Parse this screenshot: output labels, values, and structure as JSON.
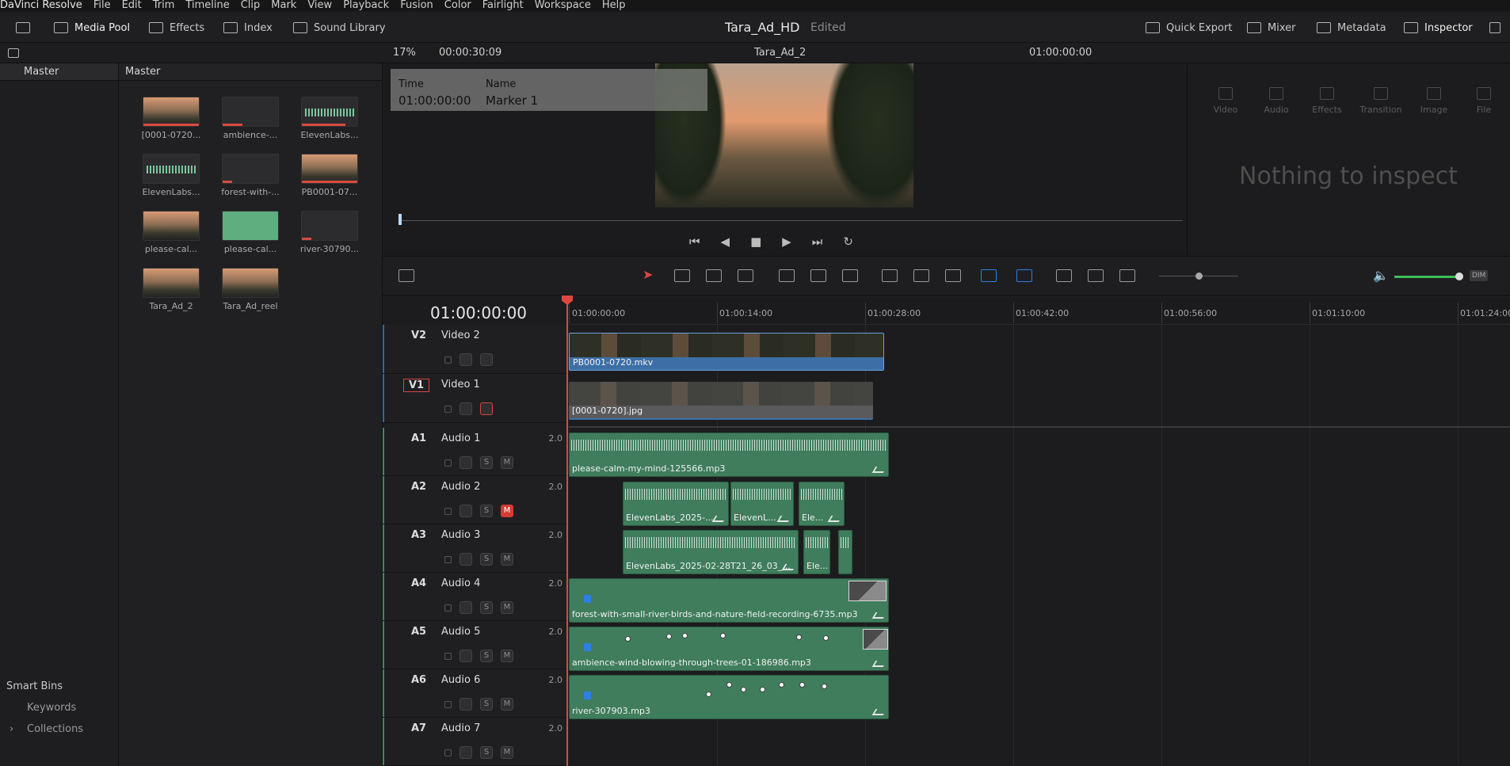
{
  "menubar": [
    "DaVinci Resolve",
    "File",
    "Edit",
    "Trim",
    "Timeline",
    "Clip",
    "Mark",
    "View",
    "Playback",
    "Fusion",
    "Color",
    "Fairlight",
    "Workspace",
    "Help"
  ],
  "toolbar": {
    "media_pool": "Media Pool",
    "effects": "Effects",
    "index": "Index",
    "sound_library": "Sound Library",
    "project_title": "Tara_Ad_HD",
    "edited": "Edited",
    "quick_export": "Quick Export",
    "mixer": "Mixer",
    "metadata": "Metadata",
    "inspector": "Inspector"
  },
  "strip2": {
    "zoom": "17%",
    "duration": "00:00:30:09",
    "timeline_name": "Tara_Ad_2",
    "timecode": "01:00:00:00"
  },
  "bins": {
    "master": "Master",
    "smart_bins": "Smart Bins",
    "keywords": "Keywords",
    "collections": "Collections"
  },
  "pool": {
    "header": "Master",
    "clips": [
      {
        "name": "[0001-0720..."
      },
      {
        "name": "ambience-..."
      },
      {
        "name": "ElevenLabs..."
      },
      {
        "name": "ElevenLabs..."
      },
      {
        "name": "forest-with-..."
      },
      {
        "name": "PB0001-07..."
      },
      {
        "name": "please-cal..."
      },
      {
        "name": "please-cal..."
      },
      {
        "name": "river-30790..."
      },
      {
        "name": "Tara_Ad_2"
      },
      {
        "name": "Tara_Ad_reel"
      }
    ]
  },
  "viewer": {
    "marker_time_label": "Time",
    "marker_name_label": "Name",
    "marker_time": "01:00:00:00",
    "marker_name": "Marker 1"
  },
  "inspector": {
    "tabs": [
      "Video",
      "Audio",
      "Effects",
      "Transition",
      "Image",
      "File"
    ],
    "empty_message": "Nothing to inspect"
  },
  "timeline": {
    "current_tc": "01:00:00:00",
    "ruler": [
      "01:00:00:00",
      "01:00:14:00",
      "01:00:28:00",
      "01:00:42:00",
      "01:00:56:00",
      "01:01:10:00",
      "01:01:24:00"
    ],
    "tracks": [
      {
        "id": "V2",
        "name": "Video 2"
      },
      {
        "id": "V1",
        "name": "Video 1"
      },
      {
        "id": "A1",
        "name": "Audio 1",
        "vol": "2.0"
      },
      {
        "id": "A2",
        "name": "Audio 2",
        "vol": "2.0"
      },
      {
        "id": "A3",
        "name": "Audio 3",
        "vol": "2.0"
      },
      {
        "id": "A4",
        "name": "Audio 4",
        "vol": "2.0"
      },
      {
        "id": "A5",
        "name": "Audio 5",
        "vol": "2.0"
      },
      {
        "id": "A6",
        "name": "Audio 6",
        "vol": "2.0"
      },
      {
        "id": "A7",
        "name": "Audio 7",
        "vol": "2.0"
      }
    ],
    "clips": {
      "v2": "PB0001-0720.mkv",
      "v1": "[0001-0720].jpg",
      "a1": "please-calm-my-mind-125566.mp3",
      "a2_1": "ElevenLabs_2025-...",
      "a2_2": "ElevenL...",
      "a2_3": "Ele...",
      "a3_1": "ElevenLabs_2025-02-28T21_26_03_...",
      "a3_2": "Ele...",
      "a4": "forest-with-small-river-birds-and-nature-field-recording-6735.mp3",
      "a5": "ambience-wind-blowing-through-trees-01-186986.mp3",
      "a6": "river-307903.mp3"
    },
    "solo": "S",
    "mute": "M",
    "dim": "DIM"
  },
  "colors": {
    "playhead": "#e0463d",
    "video_clip": "#3d6fa6",
    "audio_clip": "#3f7d5c",
    "mute_active": "#d43b33"
  }
}
